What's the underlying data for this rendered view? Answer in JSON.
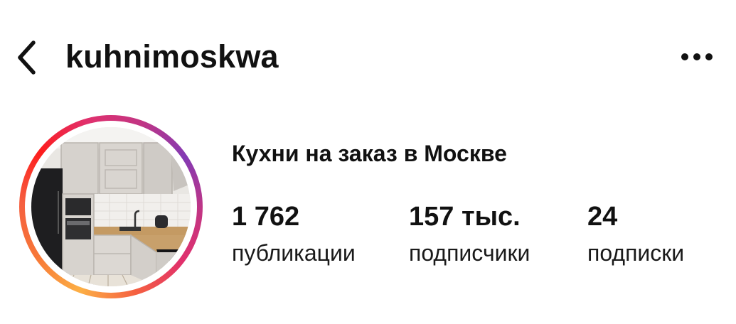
{
  "header": {
    "back_icon": "chevron-left-icon",
    "username": "kuhnimoskwa",
    "more_icon": "more-horizontal-icon"
  },
  "profile": {
    "avatar_icon": "kitchen-photo",
    "name": "Кухни на заказ в Москве",
    "stats": [
      {
        "value": "1 762",
        "label": "публикации"
      },
      {
        "value": "157 тыс.",
        "label": "подписчики"
      },
      {
        "value": "24",
        "label": "подписки"
      }
    ]
  }
}
